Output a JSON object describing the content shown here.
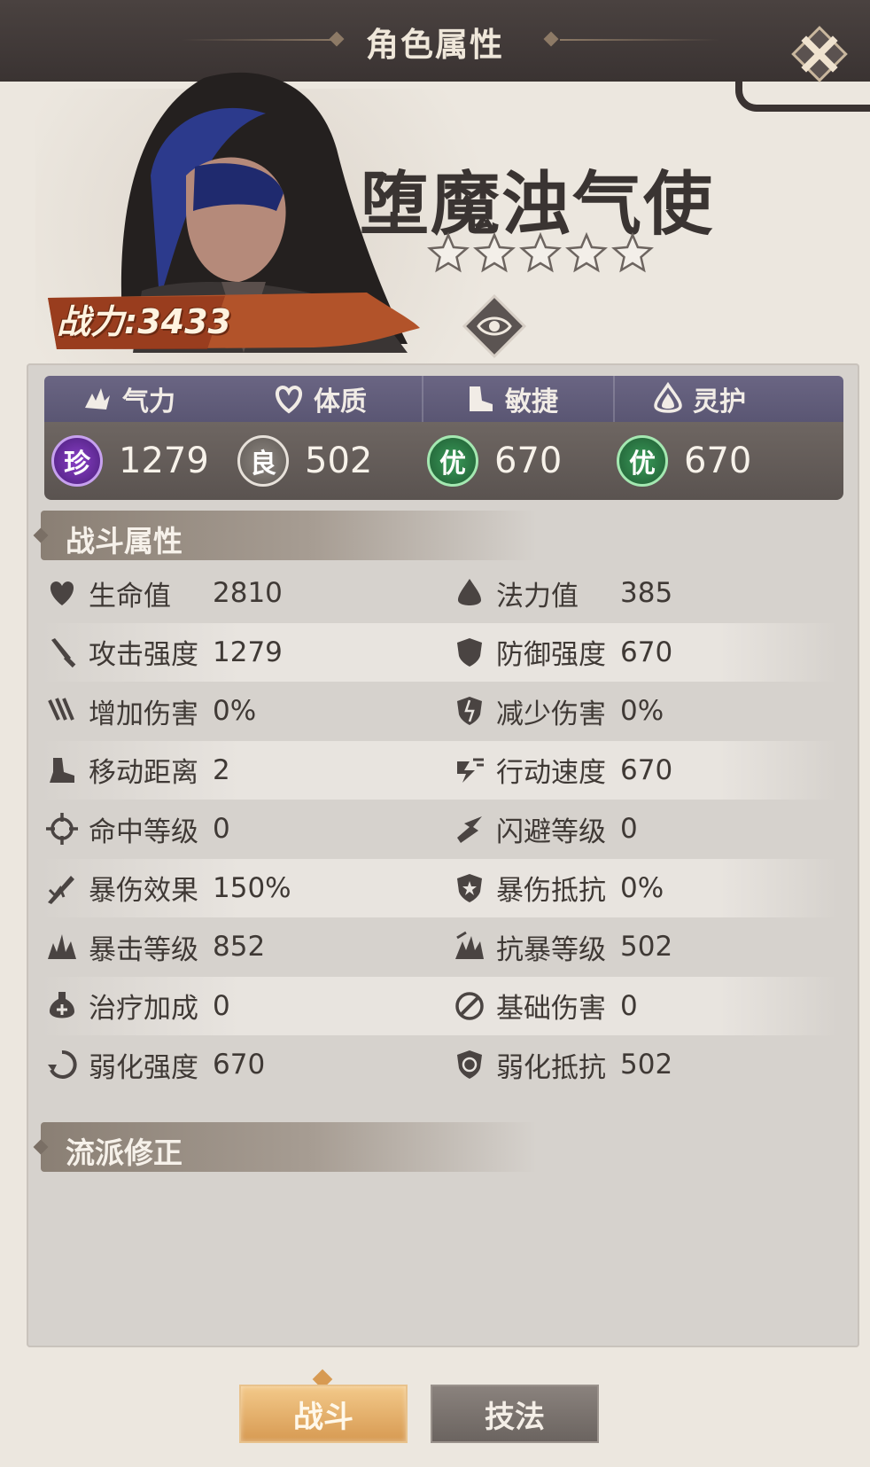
{
  "window": {
    "title": "角色属性"
  },
  "character": {
    "name": "堕魔浊气使",
    "power_label": "战力:",
    "power_value": "3433",
    "stars": 5
  },
  "main_attributes": [
    {
      "name": "气力",
      "icon": "strength-icon",
      "grade": "珍",
      "grade_color": "#8a3fc7",
      "value": "1279"
    },
    {
      "name": "体质",
      "icon": "heart-icon",
      "grade": "良",
      "grade_color": "#7a746f",
      "value": "502"
    },
    {
      "name": "敏捷",
      "icon": "boot-icon",
      "grade": "优",
      "grade_color": "#2f8a4f",
      "value": "670"
    },
    {
      "name": "灵护",
      "icon": "spirit-drop-icon",
      "grade": "优",
      "grade_color": "#2f8a4f",
      "value": "670"
    }
  ],
  "combat_section": {
    "title": "战斗属性"
  },
  "combat_stats": [
    {
      "left": {
        "icon": "heart-icon",
        "label": "生命值",
        "value": "2810"
      },
      "right": {
        "icon": "water-drop-icon",
        "label": "法力值",
        "value": "385"
      }
    },
    {
      "left": {
        "icon": "sword-icon",
        "label": "攻击强度",
        "value": "1279"
      },
      "right": {
        "icon": "shield-icon",
        "label": "防御强度",
        "value": "670"
      }
    },
    {
      "left": {
        "icon": "claw-icon",
        "label": "增加伤害",
        "value": "0%"
      },
      "right": {
        "icon": "broken-shield-icon",
        "label": "减少伤害",
        "value": "0%"
      }
    },
    {
      "left": {
        "icon": "boot-icon",
        "label": "移动距离",
        "value": "2"
      },
      "right": {
        "icon": "speed-icon",
        "label": "行动速度",
        "value": "670"
      }
    },
    {
      "left": {
        "icon": "crosshair-icon",
        "label": "命中等级",
        "value": "0"
      },
      "right": {
        "icon": "dodge-icon",
        "label": "闪避等级",
        "value": "0"
      }
    },
    {
      "left": {
        "icon": "crit-damage-icon",
        "label": "暴伤效果",
        "value": "150%"
      },
      "right": {
        "icon": "crit-shield-icon",
        "label": "暴伤抵抗",
        "value": "0%"
      }
    },
    {
      "left": {
        "icon": "burst-icon",
        "label": "暴击等级",
        "value": "852"
      },
      "right": {
        "icon": "anti-crit-icon",
        "label": "抗暴等级",
        "value": "502"
      }
    },
    {
      "left": {
        "icon": "heal-flask-icon",
        "label": "治疗加成",
        "value": "0"
      },
      "right": {
        "icon": "base-damage-icon",
        "label": "基础伤害",
        "value": "0"
      }
    },
    {
      "left": {
        "icon": "weaken-icon",
        "label": "弱化强度",
        "value": "670"
      },
      "right": {
        "icon": "weaken-resist-icon",
        "label": "弱化抵抗",
        "value": "502"
      }
    }
  ],
  "school_section": {
    "title": "流派修正"
  },
  "tabs": [
    {
      "label": "战斗",
      "active": true
    },
    {
      "label": "技法",
      "active": false
    }
  ],
  "colors": {
    "title_bar": "#3a3332",
    "attr_header": "#5f5b78",
    "active_tab": "#d79a52",
    "inactive_tab": "#6b6460"
  }
}
